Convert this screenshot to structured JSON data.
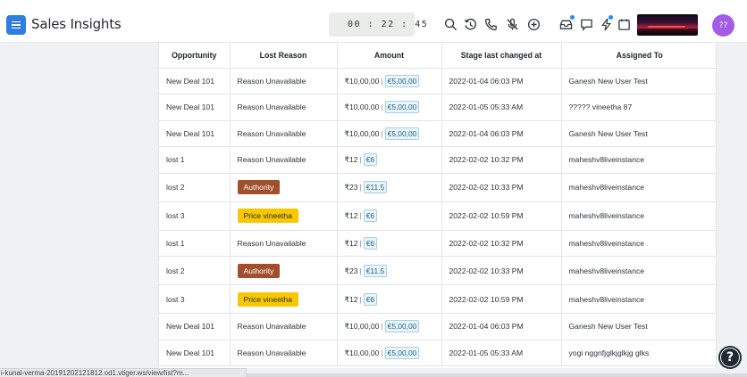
{
  "header": {
    "app_title": "Sales Insights",
    "timer": "00 : 22 : 45",
    "avatar_initials": "??",
    "icons": [
      "search-icon",
      "history-icon",
      "phone-icon",
      "mic-off-icon",
      "add-circle-icon",
      "inbox-icon",
      "chat-icon",
      "lightning-icon",
      "calendar-icon"
    ],
    "accent_color": "#2f7de1",
    "avatar_color": "#a45ce6"
  },
  "table": {
    "columns": [
      "Opportunity",
      "Lost Reason",
      "Amount",
      "Stage last changed at",
      "Assigned To"
    ],
    "rows": [
      {
        "opportunity": "New Deal 101",
        "lost_reason": "Reason Unavailable",
        "tag": "",
        "amount": "₹10,00,00",
        "amount_converted": "€5,00,00",
        "stage_changed": "2022-01-04 06:03 PM",
        "assigned_to": "Ganesh New User Test"
      },
      {
        "opportunity": "New Deal 101",
        "lost_reason": "Reason Unavailable",
        "tag": "",
        "amount": "₹10,00,00",
        "amount_converted": "€5,00,00",
        "stage_changed": "2022-01-05 05:33 AM",
        "assigned_to": "????? vineetha 87"
      },
      {
        "opportunity": "New Deal 101",
        "lost_reason": "Reason Unavailable",
        "tag": "",
        "amount": "₹10,00,00",
        "amount_converted": "€5,00,00",
        "stage_changed": "2022-01-04 06:03 PM",
        "assigned_to": "Ganesh New User Test"
      },
      {
        "opportunity": "lost 1",
        "lost_reason": "Reason Unavailable",
        "tag": "",
        "amount": "₹12",
        "amount_converted": "€6",
        "stage_changed": "2022-02-02 10:32 PM",
        "assigned_to": "maheshv8liveinstance"
      },
      {
        "opportunity": "lost 2",
        "lost_reason": "Authority",
        "tag": "brown",
        "amount": "₹23",
        "amount_converted": "€11.5",
        "stage_changed": "2022-02-02 10:33 PM",
        "assigned_to": "maheshv8liveinstance"
      },
      {
        "opportunity": "lost 3",
        "lost_reason": "Price vineetha",
        "tag": "yellow",
        "amount": "₹12",
        "amount_converted": "€6",
        "stage_changed": "2022-02-02 10:59 PM",
        "assigned_to": "maheshv8liveinstance"
      },
      {
        "opportunity": "lost 1",
        "lost_reason": "Reason Unavailable",
        "tag": "",
        "amount": "₹12",
        "amount_converted": "€6",
        "stage_changed": "2022-02-02 10:32 PM",
        "assigned_to": "maheshv8liveinstance"
      },
      {
        "opportunity": "lost 2",
        "lost_reason": "Authority",
        "tag": "brown",
        "amount": "₹23",
        "amount_converted": "€11.5",
        "stage_changed": "2022-02-02 10:33 PM",
        "assigned_to": "maheshv8liveinstance"
      },
      {
        "opportunity": "lost 3",
        "lost_reason": "Price vineetha",
        "tag": "yellow",
        "amount": "₹12",
        "amount_converted": "€6",
        "stage_changed": "2022-02-02 10:59 PM",
        "assigned_to": "maheshv8liveinstance"
      },
      {
        "opportunity": "New Deal 101",
        "lost_reason": "Reason Unavailable",
        "tag": "",
        "amount": "₹10,00,00",
        "amount_converted": "€5,00,00",
        "stage_changed": "2022-01-04 06:03 PM",
        "assigned_to": "Ganesh New User Test"
      },
      {
        "opportunity": "New Deal 101",
        "lost_reason": "Reason Unavailable",
        "tag": "",
        "amount": "₹10,00,00",
        "amount_converted": "€5,00,00",
        "stage_changed": "2022-01-05 05:33 AM",
        "assigned_to": "yogi nggnfjglkjglkjg glks"
      }
    ]
  },
  "status_bar": {
    "url": "i-kunal-verma-20191202121812.od1.vtiger.ws/view/list?m..."
  },
  "help": {
    "label": "?"
  }
}
